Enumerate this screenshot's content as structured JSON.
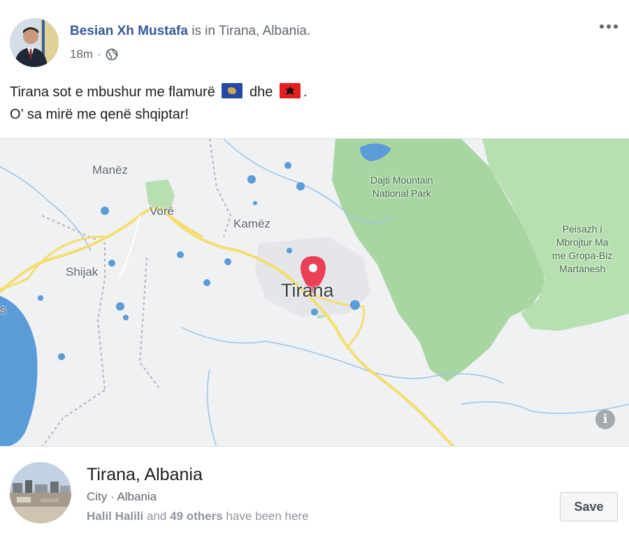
{
  "post": {
    "author": "Besian Xh Mustafa",
    "checkin_text": "is in Tirana, Albania.",
    "timestamp": "18m",
    "separator": "·",
    "privacy_icon": "globe-icon",
    "more_icon": "more-options-icon",
    "text_line1_a": "Tirana sot e mbushur me flamurë",
    "text_line1_b": "dhe",
    "text_line1_c": ".",
    "text_line2": "O’ sa mirë me qenë shqiptar!"
  },
  "map": {
    "labels": {
      "manez": "Manëz",
      "vore": "Vorë",
      "kamez": "Kamëz",
      "shijak": "Shijak",
      "tirana": "Tirana",
      "edge": "s",
      "dajti_line1": "Dajti Mountain",
      "dajti_line2": "National Park",
      "peisazh_line1": "Peisazh i",
      "peisazh_line2": "Mbrojtur Ma",
      "peisazh_line3": "me Gropa-Biz",
      "peisazh_line4": "Martanesh"
    },
    "info_icon": "i",
    "colors": {
      "park": "#a8d5a2",
      "road": "#f7e27a",
      "water": "#5b9bd8",
      "pin": "#ea4056"
    }
  },
  "place": {
    "name": "Tirana, Albania",
    "type": "City · Albania",
    "visitor_name": "Halil Halili",
    "visitor_and": "and",
    "visitor_count": "49 others",
    "visitor_suffix": "have been here",
    "save_label": "Save"
  }
}
